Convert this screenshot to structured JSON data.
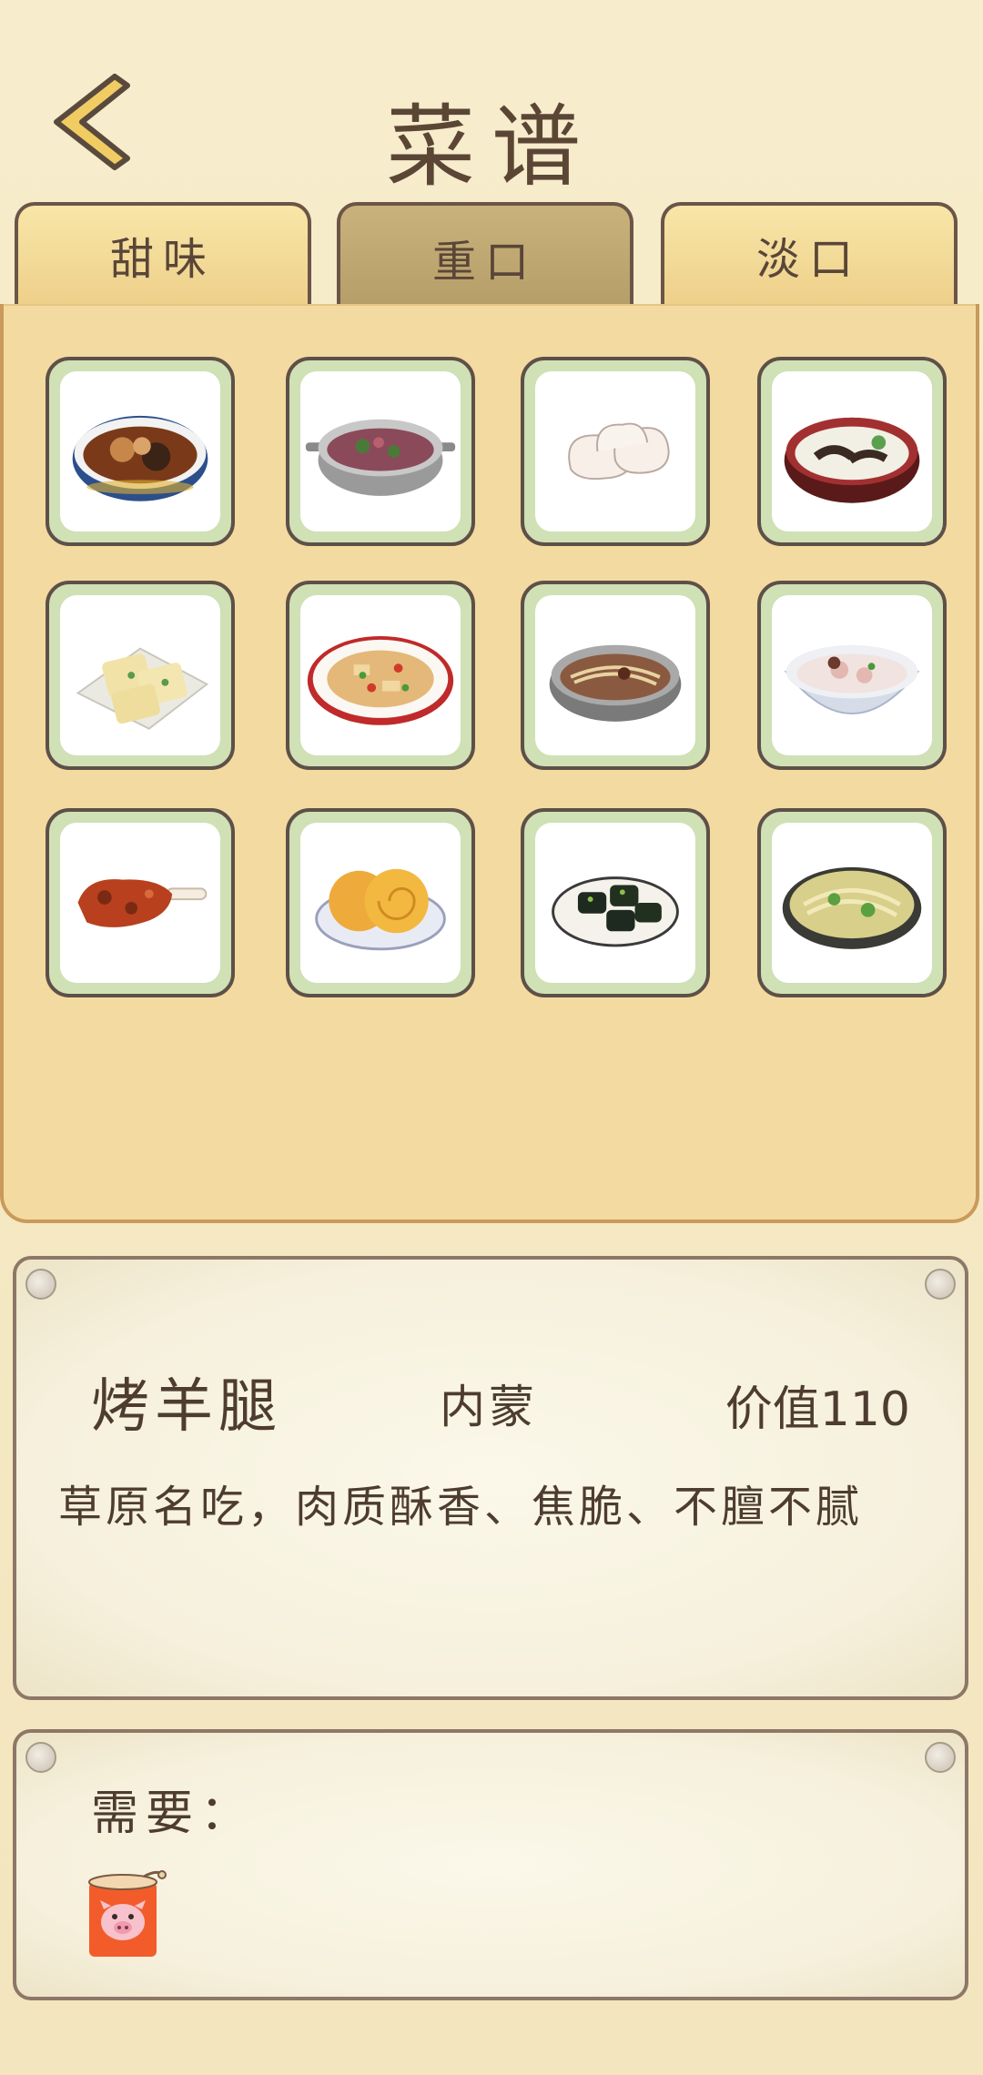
{
  "header": {
    "title": "菜谱"
  },
  "tabs": [
    {
      "label": "甜味",
      "active": false
    },
    {
      "label": "重口",
      "active": true
    },
    {
      "label": "淡口",
      "active": false
    }
  ],
  "dishes": [
    {
      "icon": "braised-meat-bowl-icon"
    },
    {
      "icon": "stew-pot-icon"
    },
    {
      "icon": "dumplings-icon"
    },
    {
      "icon": "mushroom-soup-bowl-icon"
    },
    {
      "icon": "tofu-plate-icon"
    },
    {
      "icon": "stir-fry-plate-icon"
    },
    {
      "icon": "noodle-pot-icon"
    },
    {
      "icon": "soup-bowl-icon"
    },
    {
      "icon": "roast-lamb-leg-icon"
    },
    {
      "icon": "flatbread-plate-icon"
    },
    {
      "icon": "dark-cakes-plate-icon"
    },
    {
      "icon": "noodle-bowl-icon"
    }
  ],
  "detail": {
    "name": "烤羊腿",
    "region": "内蒙",
    "value": "价值110",
    "description": "草原名吃，肉质酥香、焦脆、不膻不腻"
  },
  "requirements": {
    "label": "需要：",
    "items": [
      {
        "icon": "pig-can-icon"
      }
    ]
  },
  "colors": {
    "panel": "#f3daa0",
    "card_border": "#cfe1b5",
    "active_tab": "#b59d68",
    "text": "#4e3c30"
  }
}
